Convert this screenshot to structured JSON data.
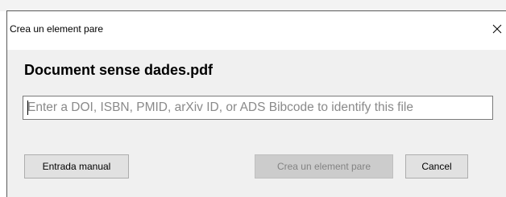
{
  "dialog": {
    "title": "Crea un element pare",
    "heading": "Document sense dades.pdf",
    "identifier_input": {
      "value": "",
      "placeholder": "Enter a DOI, ISBN, PMID, arXiv ID, or ADS Bibcode to identify this file"
    },
    "buttons": {
      "manual_entry": "Entrada manual",
      "create_parent": "Crea un element pare",
      "cancel": "Cancel"
    },
    "create_parent_enabled": false
  },
  "icons": {
    "close": "close-icon"
  }
}
